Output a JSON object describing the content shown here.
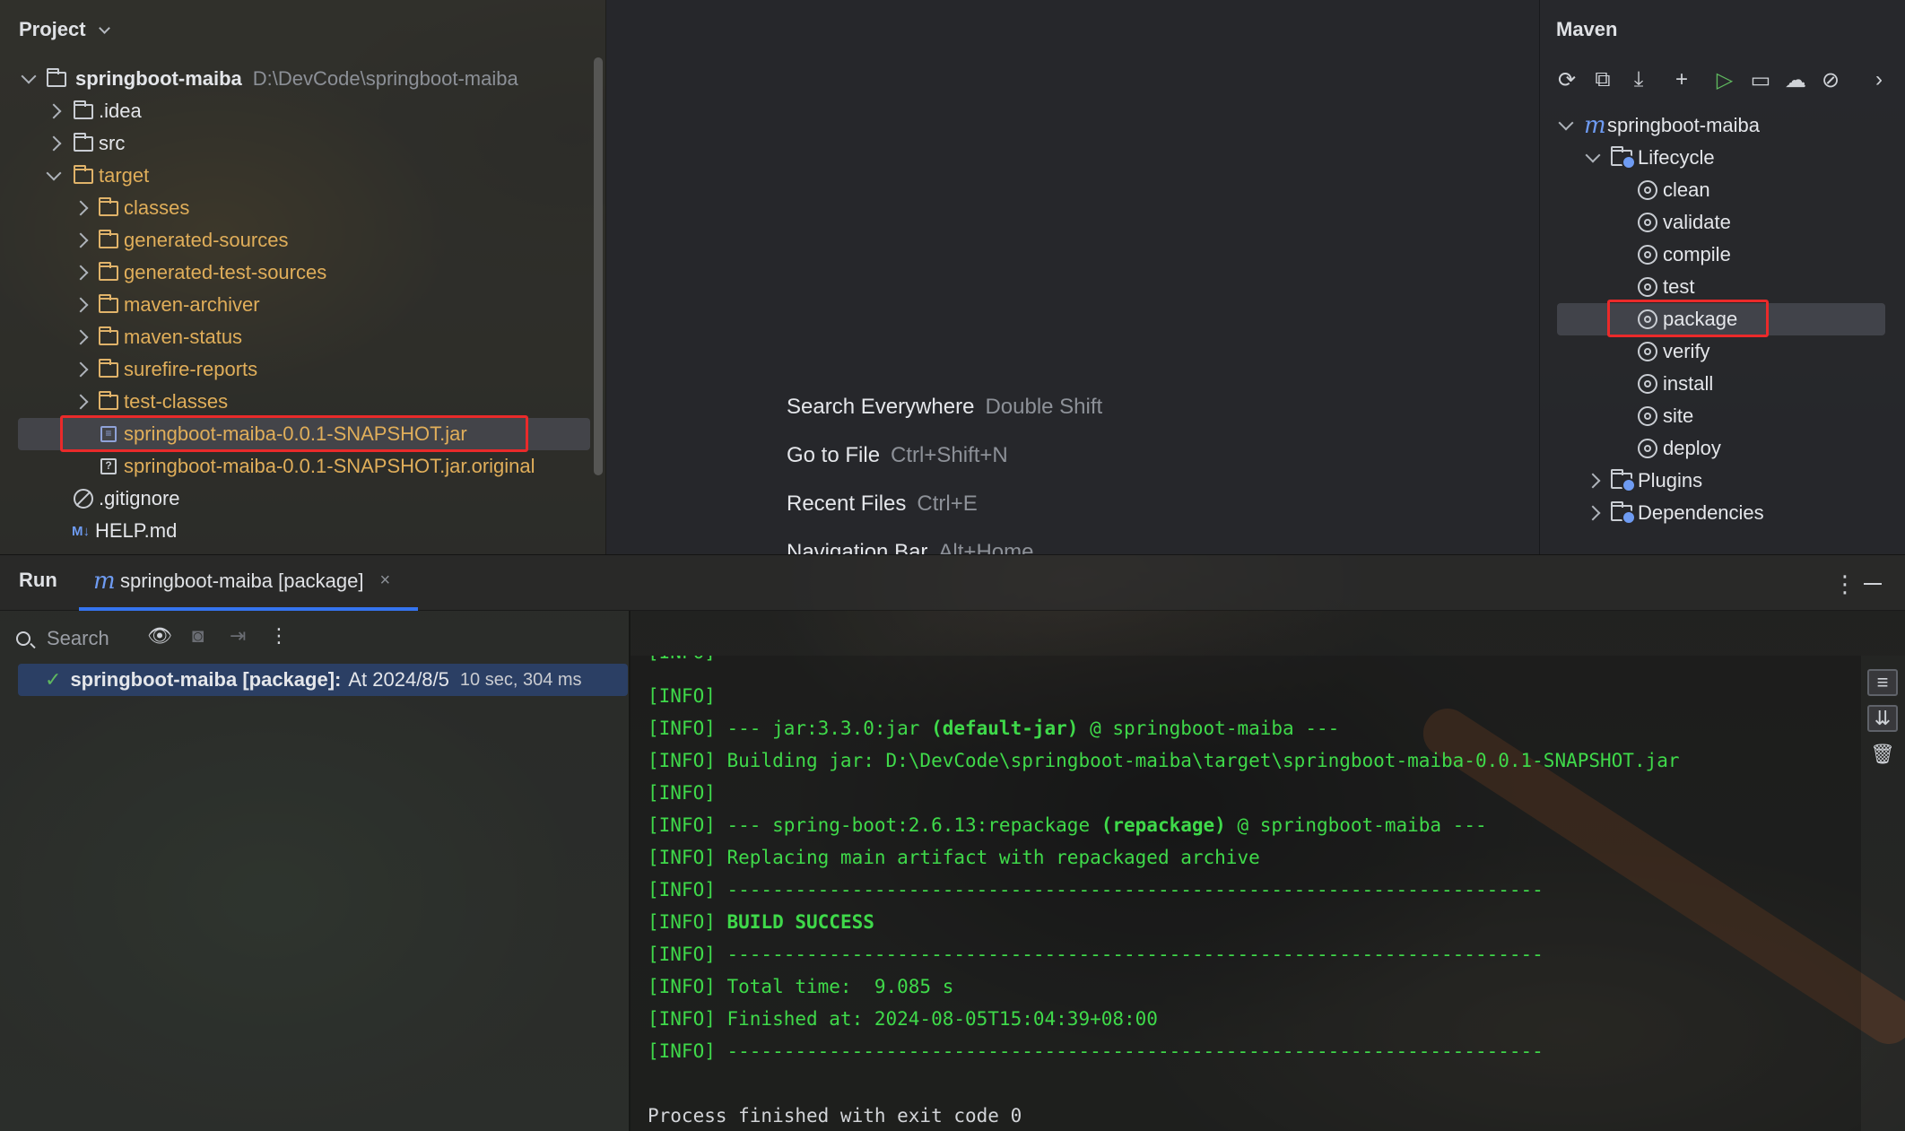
{
  "project_panel": {
    "title": "Project",
    "root": {
      "name": "springboot-maiba",
      "path": "D:\\DevCode\\springboot-maiba"
    },
    "items": [
      {
        "label": ".idea"
      },
      {
        "label": "src"
      },
      {
        "label": "target"
      },
      {
        "label": "classes"
      },
      {
        "label": "generated-sources"
      },
      {
        "label": "generated-test-sources"
      },
      {
        "label": "maven-archiver"
      },
      {
        "label": "maven-status"
      },
      {
        "label": "surefire-reports"
      },
      {
        "label": "test-classes"
      },
      {
        "label": "springboot-maiba-0.0.1-SNAPSHOT.jar"
      },
      {
        "label": "springboot-maiba-0.0.1-SNAPSHOT.jar.original"
      },
      {
        "label": ".gitignore"
      },
      {
        "label": "HELP.md"
      }
    ]
  },
  "editor_hints": [
    {
      "action": "Search Everywhere",
      "shortcut": "Double Shift"
    },
    {
      "action": "Go to File",
      "shortcut": "Ctrl+Shift+N"
    },
    {
      "action": "Recent Files",
      "shortcut": "Ctrl+E"
    },
    {
      "action": "Navigation Bar",
      "shortcut": "Alt+Home"
    }
  ],
  "maven_panel": {
    "title": "Maven",
    "project": "springboot-maiba",
    "lifecycle_label": "Lifecycle",
    "goals": [
      "clean",
      "validate",
      "compile",
      "test",
      "package",
      "verify",
      "install",
      "site",
      "deploy"
    ],
    "plugins_label": "Plugins",
    "dependencies_label": "Dependencies"
  },
  "run_panel": {
    "title": "Run",
    "tab_label": "springboot-maiba [package]",
    "search_placeholder": "Search",
    "run_item": {
      "name": "springboot-maiba [package]:",
      "status": "At 2024/8/5",
      "duration": "10 sec, 304 ms"
    }
  },
  "console": {
    "lines": [
      {
        "prefix": "[INFO]",
        "text": ""
      },
      {
        "prefix": "[INFO]",
        "text": ""
      },
      {
        "prefix": "[INFO]",
        "pre": " --- jar:3.3.0:jar ",
        "bold": "(default-jar)",
        "post": " @ springboot-maiba ---"
      },
      {
        "prefix": "[INFO]",
        "text": " Building jar: D:\\DevCode\\springboot-maiba\\target\\springboot-maiba-0.0.1-SNAPSHOT.jar"
      },
      {
        "prefix": "[INFO]",
        "text": ""
      },
      {
        "prefix": "[INFO]",
        "pre": " --- spring-boot:2.6.13:repackage ",
        "bold": "(repackage)",
        "post": " @ springboot-maiba ---"
      },
      {
        "prefix": "[INFO]",
        "text": " Replacing main artifact with repackaged archive"
      },
      {
        "prefix": "[INFO]",
        "text": " ------------------------------------------------------------------------"
      },
      {
        "prefix": "[INFO]",
        "pre": " ",
        "bold": "BUILD SUCCESS",
        "post": ""
      },
      {
        "prefix": "[INFO]",
        "text": " ------------------------------------------------------------------------"
      },
      {
        "prefix": "[INFO]",
        "text": " Total time:  9.085 s"
      },
      {
        "prefix": "[INFO]",
        "text": " Finished at: 2024-08-05T15:04:39+08:00"
      },
      {
        "prefix": "[INFO]",
        "text": " ------------------------------------------------------------------------"
      }
    ],
    "exit_message": "Process finished with exit code 0"
  },
  "colors": {
    "accent": "#3574f0",
    "highlight_red": "#ea2a2a",
    "console_green": "#3fd94a",
    "excluded_orange": "#e0ae5a"
  }
}
